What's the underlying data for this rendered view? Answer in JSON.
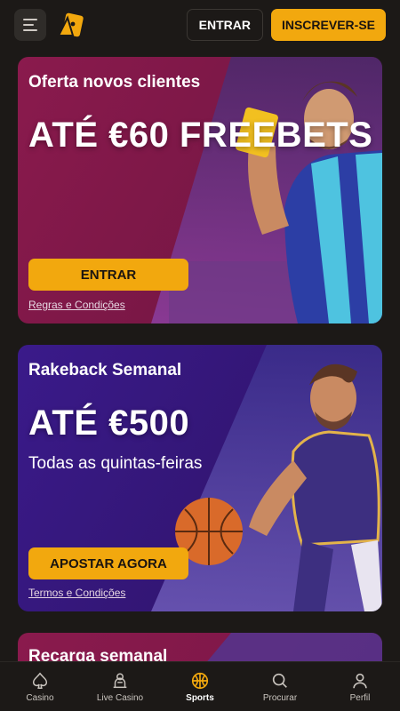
{
  "header": {
    "login_label": "ENTRAR",
    "signup_label": "INSCREVER-SE"
  },
  "promos": [
    {
      "subtitle": "Oferta novos clientes",
      "title": "ATÉ €60 FREEBETS",
      "description": "",
      "cta_label": "ENTRAR",
      "terms_label": "Regras e Condições"
    },
    {
      "subtitle": "Rakeback Semanal",
      "title": "ATÉ €500",
      "description": "Todas as quintas-feiras",
      "cta_label": "APOSTAR AGORA",
      "terms_label": "Termos e Condições"
    },
    {
      "subtitle": "Recarga semanal"
    }
  ],
  "nav": {
    "items": [
      {
        "label": "Casino",
        "icon": "spade-icon"
      },
      {
        "label": "Live Casino",
        "icon": "dealer-icon"
      },
      {
        "label": "Sports",
        "icon": "ball-icon",
        "active": true
      },
      {
        "label": "Procurar",
        "icon": "search-icon"
      },
      {
        "label": "Perfil",
        "icon": "user-icon"
      }
    ]
  },
  "colors": {
    "accent": "#f2a80e",
    "background": "#1c1917",
    "card_red": "#7a1746",
    "card_purple": "#331675"
  }
}
